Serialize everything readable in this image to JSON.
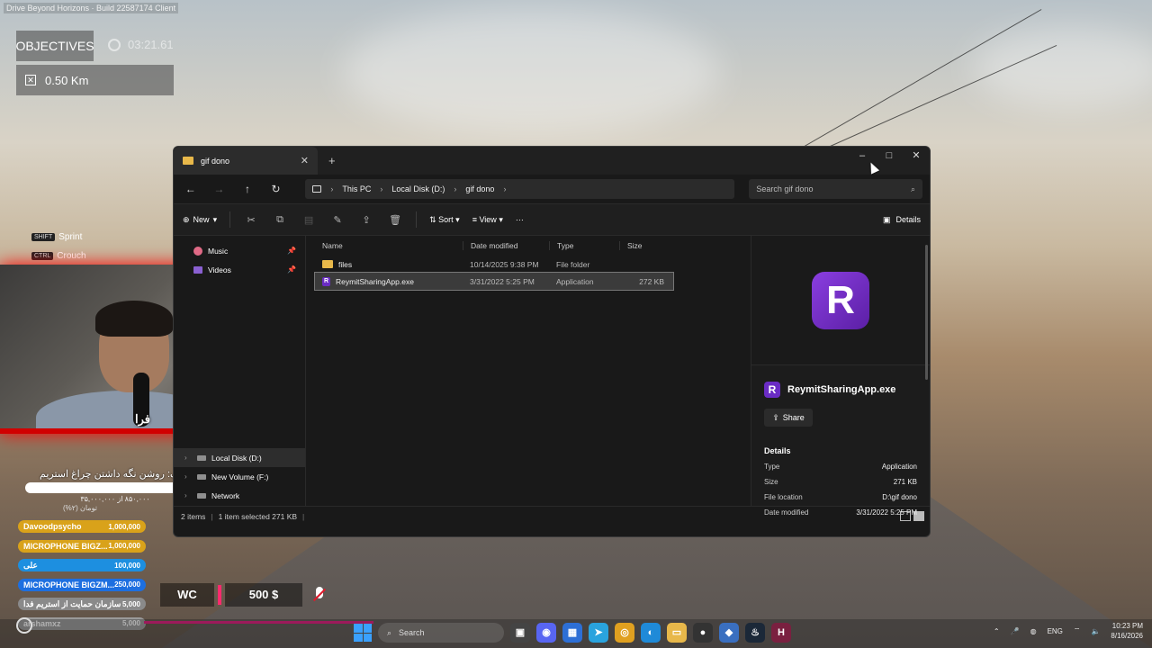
{
  "game": {
    "build": "Drive Beyond Horizons · Build 22587174 Client",
    "objectives_label": "OBJECTIVES",
    "timer": "03:21.61",
    "distance": "0.50 Km",
    "hints": [
      {
        "key": "SHIFT",
        "label": "Sprint"
      },
      {
        "key": "CTRL",
        "label": "Crouch"
      }
    ],
    "hud_wc": "WC",
    "hud_money": "500 $"
  },
  "stream": {
    "webcam_tag": "فرا",
    "goal_title": "هدف: روشن نگه داشتن چراغ استریم",
    "goal_pct": "%۲",
    "goal_sub": "۸۵۰,۰۰۰ از ۳۵,۰۰۰,۰۰۰",
    "goal_sub2": "تومان (۲%)",
    "donors": [
      {
        "name": "Davoodpsycho",
        "amount": "1,000,000",
        "color": "#d9a21a"
      },
      {
        "name": "MICROPHONE BIGZ...",
        "amount": "1,000,000",
        "color": "#d9a21a"
      },
      {
        "name": "علی",
        "amount": "100,000",
        "color": "#1d8fe0"
      },
      {
        "name": "MICROPHONE BIGZM...",
        "amount": "250,000",
        "color": "#1d6fe0"
      },
      {
        "name": "سازمان حمایت از استریم فدا",
        "amount": "5,000",
        "color": "#8a8a8a"
      },
      {
        "name": "arshamxz",
        "amount": "5,000",
        "color": "#9a9a9a"
      }
    ]
  },
  "explorer": {
    "tab_title": "gif dono",
    "window_controls": {
      "minimize": "–",
      "maximize": "□",
      "close": "✕"
    },
    "path": [
      "This PC",
      "Local Disk (D:)",
      "gif dono"
    ],
    "search_placeholder": "Search gif dono",
    "toolbar": {
      "new": "New",
      "sort": "Sort",
      "view": "View",
      "more": "···",
      "details": "Details"
    },
    "sidebar": [
      {
        "label": "Music",
        "icon": "music-icon",
        "pinned": true
      },
      {
        "label": "Videos",
        "icon": "video-icon",
        "pinned": true
      },
      {
        "label": "Local Disk (D:)",
        "icon": "drive-icon",
        "expand": true,
        "selected": true
      },
      {
        "label": "New Volume (F:)",
        "icon": "drive-icon",
        "expand": true
      },
      {
        "label": "Network",
        "icon": "network-icon",
        "expand": true
      }
    ],
    "columns": {
      "name": "Name",
      "date": "Date modified",
      "type": "Type",
      "size": "Size"
    },
    "files": [
      {
        "name": "files",
        "date": "10/14/2025 9:38 PM",
        "type": "File folder",
        "size": "",
        "icon": "folder-icon"
      },
      {
        "name": "ReymitSharingApp.exe",
        "date": "3/31/2022 5:25 PM",
        "type": "Application",
        "size": "272 KB",
        "icon": "app-icon",
        "selected": true
      }
    ],
    "details_pane": {
      "file_name": "ReymitSharingApp.exe",
      "share": "Share",
      "heading": "Details",
      "rows": [
        {
          "k": "Type",
          "v": "Application"
        },
        {
          "k": "Size",
          "v": "271 KB"
        },
        {
          "k": "File location",
          "v": "D:\\gif dono"
        },
        {
          "k": "Date modified",
          "v": "3/31/2022 5:25 PM"
        }
      ]
    },
    "status": {
      "items": "2 items",
      "selected": "1 item selected  271 KB"
    }
  },
  "taskbar": {
    "search": "Search",
    "lang": "ENG",
    "time": "10:23 PM",
    "date": "8/16/2026"
  }
}
